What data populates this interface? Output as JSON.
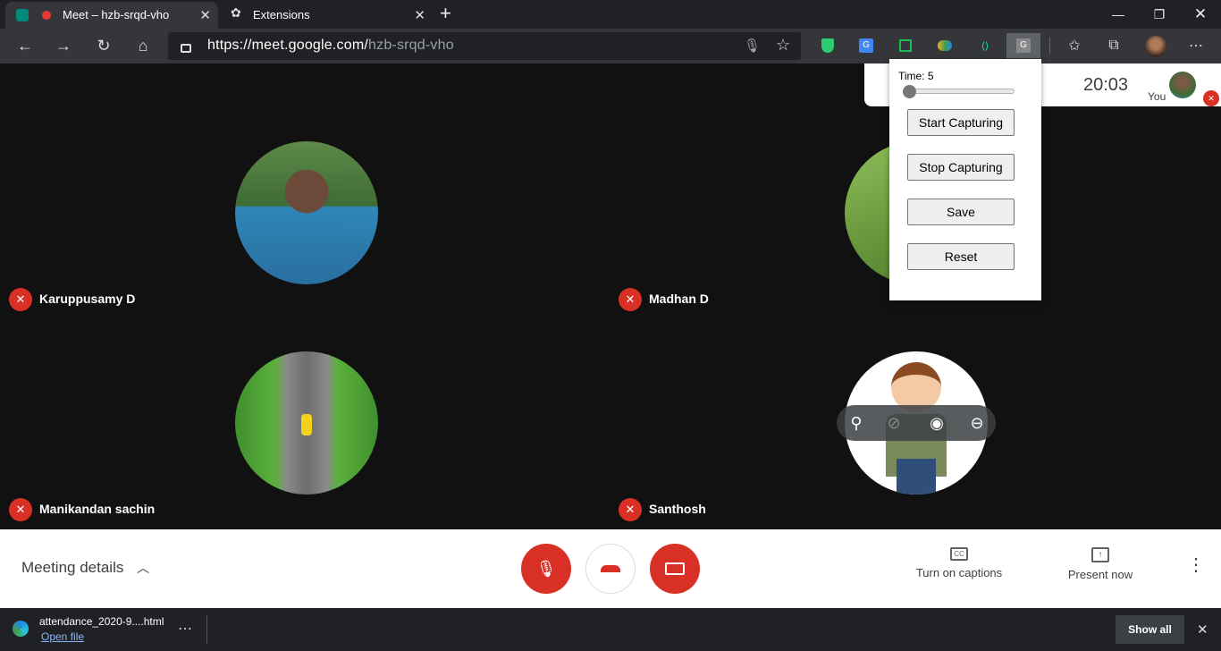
{
  "browser": {
    "tabs": [
      {
        "title": "Meet – hzb-srqd-vho",
        "active": true
      },
      {
        "title": "Extensions",
        "active": false
      }
    ],
    "new_tab_symbol": "+",
    "url_scheme_host": "https://meet.google.com/",
    "url_path": "hzb-srqd-vho",
    "extension_icons": [
      "shield-icon",
      "translate-icon",
      "sheets-icon",
      "paint-icon",
      "code-icon",
      "capture-extension-icon"
    ]
  },
  "meeting": {
    "time": "20:03",
    "self_label": "You",
    "participants": [
      {
        "name": "Karuppusamy D",
        "muted": true
      },
      {
        "name": "Madhan D",
        "muted": true
      },
      {
        "name": "Manikandan sachin",
        "muted": true
      },
      {
        "name": "Santhosh",
        "muted": true
      }
    ],
    "details_label": "Meeting details",
    "captions_label": "Turn on captions",
    "present_label": "Present now"
  },
  "popup": {
    "time_label": "Time: 5",
    "slider_value": 5,
    "start_label": "Start Capturing",
    "stop_label": "Stop Capturing",
    "save_label": "Save",
    "reset_label": "Reset"
  },
  "download": {
    "filename": "attendance_2020-9....html",
    "open_label": "Open file",
    "show_all_label": "Show all"
  },
  "colors": {
    "accent_red": "#d93025",
    "browser_dark": "#202124",
    "toolbar": "#35363a"
  }
}
